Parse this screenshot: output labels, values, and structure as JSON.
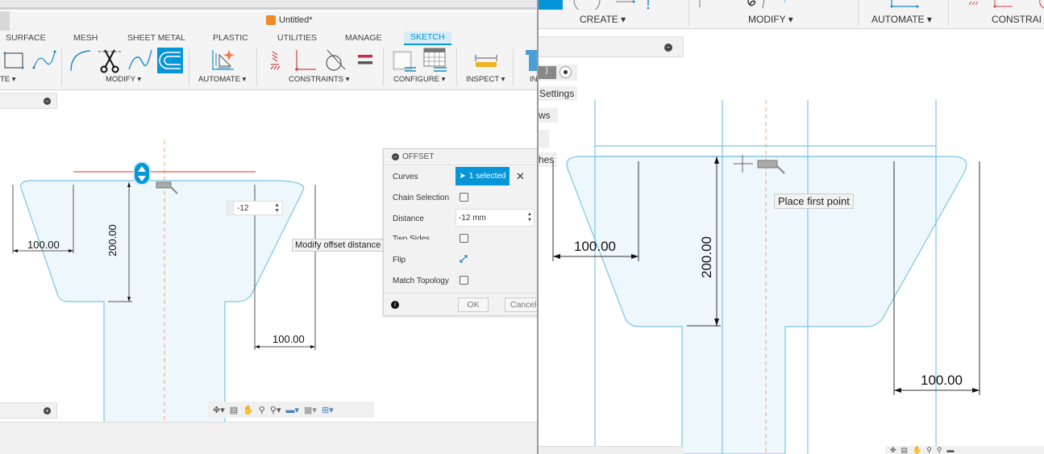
{
  "left_window": {
    "title": "Untitled*",
    "ribbon_tabs": [
      {
        "label": "SURFACE"
      },
      {
        "label": "MESH"
      },
      {
        "label": "SHEET METAL"
      },
      {
        "label": "PLASTIC"
      },
      {
        "label": "UTILITIES"
      },
      {
        "label": "MANAGE"
      },
      {
        "label": "SKETCH",
        "active": true
      }
    ],
    "ribbon_groups": [
      {
        "label": "TE ▾"
      },
      {
        "label": "MODIFY ▾"
      },
      {
        "label": "AUTOMATE ▾"
      },
      {
        "label": "CONSTRAINTS ▾"
      },
      {
        "label": "CONFIGURE ▾"
      },
      {
        "label": "INSPECT ▾"
      },
      {
        "label": "IN"
      }
    ],
    "offset_input_value": "-12",
    "tooltip": "Modify offset distance or side settings",
    "dimensions": {
      "left_width": "100.00",
      "height": "200.00",
      "right_width": "100.00"
    },
    "offset_dialog": {
      "title": "OFFSET",
      "curves_label": "Curves",
      "curves_value": "1 selected",
      "chain_selection_label": "Chain Selection",
      "chain_selection_checked": false,
      "distance_label": "Distance",
      "distance_value": "-12 mm",
      "two_sides_label": "Two Sides",
      "two_sides_checked": false,
      "flip_label": "Flip",
      "match_topology_label": "Match Topology",
      "match_topology_checked": false,
      "ok_label": "OK",
      "cancel_label": "Cancel"
    }
  },
  "right_window": {
    "ribbon_groups": [
      {
        "label": "CREATE ▾"
      },
      {
        "label": "MODIFY ▾"
      },
      {
        "label": "AUTOMATE ▾"
      },
      {
        "label": "CONSTRAI"
      }
    ],
    "browser_items": [
      {
        "label": "Settings"
      },
      {
        "label": "ws"
      },
      {
        "label": ""
      },
      {
        "label": "hes"
      }
    ],
    "tooltip": "Place first point",
    "dimensions": {
      "left_width": "100.00",
      "height": "200.00",
      "right_width": "100.00"
    }
  },
  "colors": {
    "accent": "#0696d7",
    "sketch_line": "#7cc4e4",
    "sketch_fill": "#eef7fc",
    "construction_line": "#f0a070",
    "highlight_line": "#f07070"
  }
}
